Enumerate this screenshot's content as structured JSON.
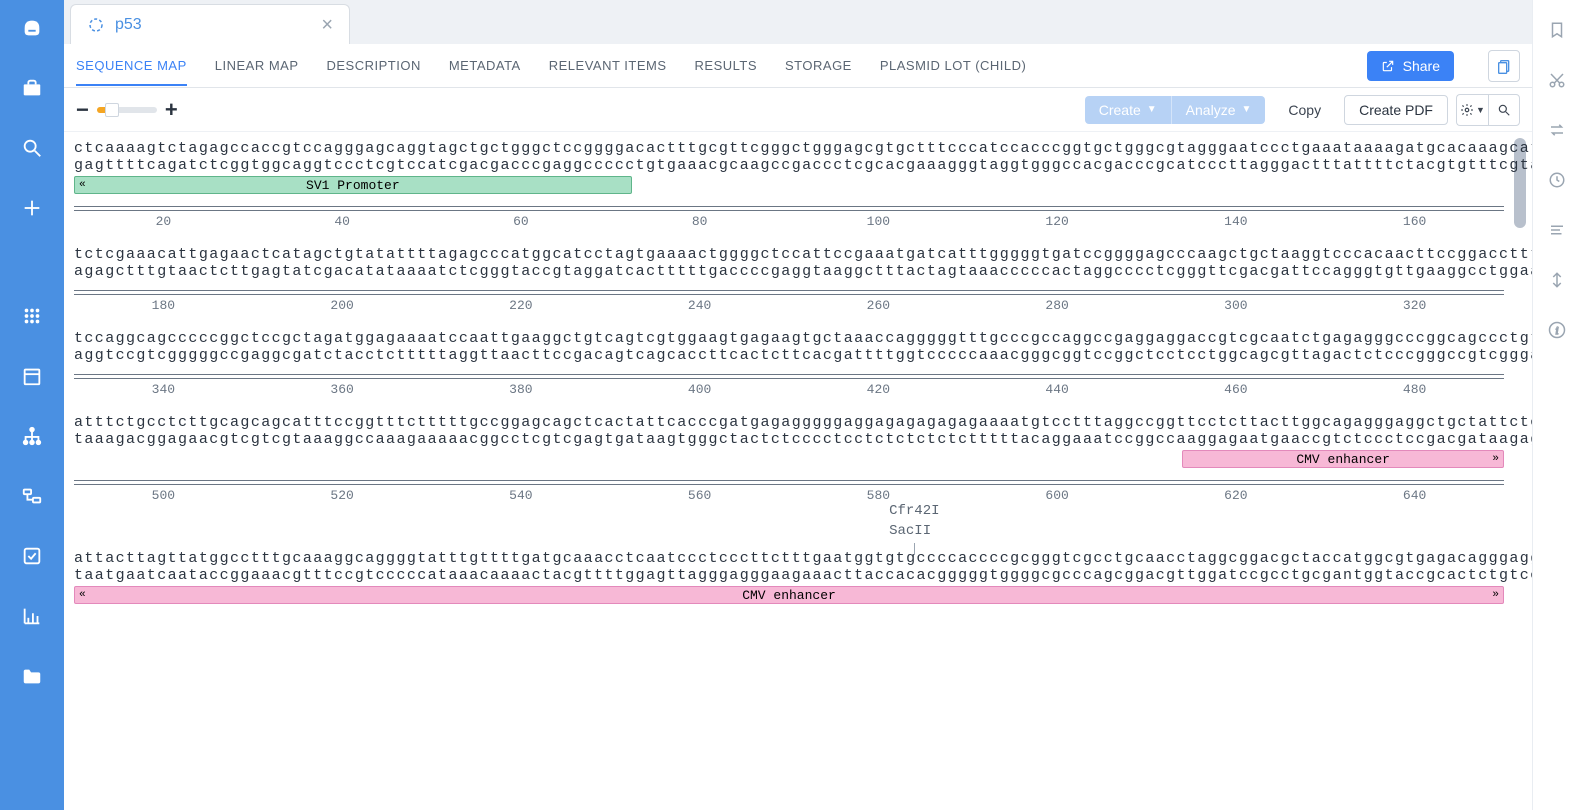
{
  "tab": {
    "title": "p53"
  },
  "subtabs": [
    "SEQUENCE MAP",
    "LINEAR MAP",
    "DESCRIPTION",
    "METADATA",
    "RELEVANT ITEMS",
    "RESULTS",
    "STORAGE",
    "PLASMID LOT (CHILD)"
  ],
  "active_subtab_index": 0,
  "share_button": "Share",
  "toolbar": {
    "create": "Create",
    "analyze": "Analyze",
    "copy": "Copy",
    "create_pdf": "Create PDF"
  },
  "features": {
    "sv1": "SV1 Promoter",
    "cmv": "CMV enhancer"
  },
  "cut_sites": {
    "cfr42i": "Cfr42I",
    "sacii": "SacII"
  },
  "rows": [
    {
      "fwd": "ctcaaaagtctagagccaccgtccagggagcaggtagctgctgggctccggggacactttgcgttcgggctgggagcgtgctttcccatccacccggtgctgggcgtagggaatccctgaaataaaagatgcacaaagcattgaggtctgagactttttgga",
      "rev": "gagttttcagatctcggtggcaggtccctcgtccatcgacgacccgaggccccctgtgaaacgcaagccgaccctcgcacgaaagggtaggtgggccacgacccgcatcccttagggactttattttctacgtgtttcgtaactccagactctgaaaacct",
      "ticks": [
        "20",
        "40",
        "60",
        "80",
        "100",
        "120",
        "140",
        "160"
      ],
      "feature": {
        "type": "green",
        "label_key": "features.sv1",
        "left": "0%",
        "width": "39%",
        "arrow": "left"
      }
    },
    {
      "fwd": "tctcgaaacattgagaactcatagctgtatattttagagcccatggcatcctagtgaaaactggggctccattccgaaatgatcatttgggggtgatccggggagcccaagctgctaaggtcccacaacttccggacctttgtccttcctggagcgatctt",
      "rev": "agagctttgtaactcttgagtatcgacatataaaatctcgggtaccgtaggatcactttttgaccccgaggtaaggctttactagtaaacccccactaggcccctcgggttcgacgattccagggtgttgaaggcctggaaacaggaaggacctcgctagaa",
      "ticks": [
        "180",
        "200",
        "220",
        "240",
        "260",
        "280",
        "300",
        "320"
      ]
    },
    {
      "fwd": "tccaggcagcccccggctccgctagatggagaaaatccaattgaaggctgtcagtcgtggaagtgagaagtgctaaaccagggggtttgcccgccaggccgaggaggaccgtcgcaatctgagagggcccggcagccctgttattgttttggctccacattttac",
      "rev": "aggtccgtcgggggccgaggcgatctacctctttttaggttaacttccgacagtcagcaccttcactcttcacgattttggtcccccaaacgggcggtccggctcctcctggcagcgttagactctcccgggccgtcgggacaataacaaaccgaggtgtaaaatg",
      "ticks": [
        "340",
        "360",
        "380",
        "400",
        "420",
        "440",
        "460",
        "480"
      ]
    },
    {
      "fwd": "atttctgcctcttgcagcagcatttccggtttctttttgccggagcagctcactattcacccgatgagagggggaggagagagagagaaaatgtcctttaggccggttcctcttacttggcagagggaggctgctattctccgcctgcatttctttttctgg",
      "rev": "taaagacggagaacgtcgtcgtaaaggccaaagaaaaacggcctcgtcgagtgataagtgggctactctcccctcctctctctctctttttacaggaaatccggccaaggagaatgaaccgtctccctccgacgataagaggcggacgtaaagaaaaagacc",
      "ticks": [
        "500",
        "520",
        "540",
        "560",
        "580",
        "600",
        "620",
        "640"
      ],
      "feature": {
        "type": "pink",
        "label_key": "features.cmv",
        "left": "77.5%",
        "width": "22.5%",
        "arrow": "right"
      }
    },
    {
      "fwd": "attacttagttatggcctttgcaaaggcaggggtatttgttttgatgcaaacctcaatccctcccttctttgaatggtgtgccccaccccgcgggtcgcctgcaacctaggcggacgctaccatggcgtgagacagggagggaaagaagtgtgcagaagg",
      "rev": "taatgaatcaataccggaaacgtttccgtcccccataaacaaaactacgttttggagttagggagggaagaaacttaccacacgggggtggggcgcccagcggacgttggatccgcctgcgantggtaccgcactctgtccctccctttcttcacacgtcttcc",
      "ticks": [],
      "cut": [
        "cut_sites.cfr42i",
        "cut_sites.sacii"
      ],
      "feature_full": {
        "type": "pink",
        "label_key": "features.cmv",
        "arrow": "both"
      }
    }
  ]
}
